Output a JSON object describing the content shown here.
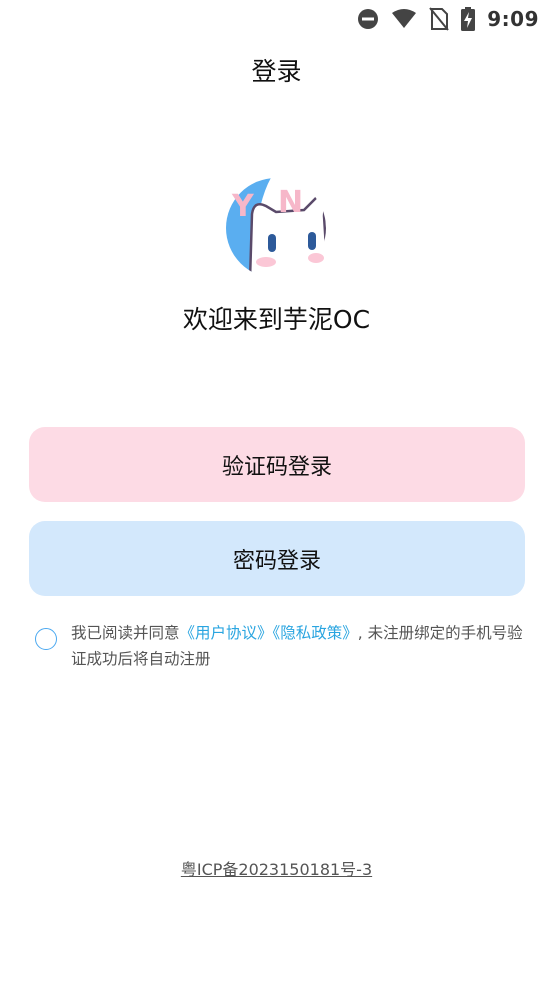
{
  "status_bar": {
    "time": "9:09",
    "icons": [
      "do-not-disturb-icon",
      "wifi-icon",
      "no-sim-icon",
      "battery-charging-icon"
    ]
  },
  "header": {
    "title": "登录"
  },
  "brand": {
    "logo_icon": "yn-cat-logo-icon",
    "logo_text": "YN",
    "welcome": "欢迎来到芋泥OC"
  },
  "actions": {
    "sms_login_label": "验证码登录",
    "password_login_label": "密码登录"
  },
  "agreement": {
    "prefix": "我已阅读并同意",
    "user_agreement": "《用户协议》",
    "privacy_policy": "《隐私政策》",
    "suffix": ", 未注册绑定的手机号验证成功后将自动注册",
    "checked": false
  },
  "footer": {
    "icp": "粤ICP备2023150181号-3"
  },
  "colors": {
    "sms_button_bg": "#fddbe5",
    "password_button_bg": "#d3e8fc",
    "link": "#2aa5e0",
    "checkbox_border": "#4aa8f0"
  }
}
